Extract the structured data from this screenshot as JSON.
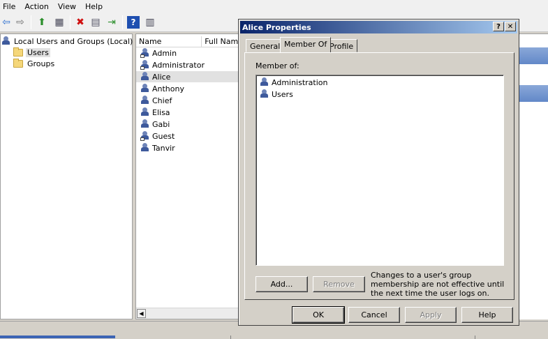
{
  "menu": [
    "File",
    "Action",
    "View",
    "Help"
  ],
  "toolbar": {
    "icons": [
      "back-arrow-icon",
      "forward-arrow-icon",
      "up-folder-icon",
      "show-hide-tree-icon",
      "delete-icon",
      "properties-icon",
      "export-list-icon",
      "help-icon",
      "show-hide-action-pane-icon"
    ],
    "glyphs": {
      "back": "⇦",
      "forward": "⇨",
      "up": "⬆",
      "tree": "▦",
      "delete": "✖",
      "props": "▤",
      "export": "⇥",
      "help": "?",
      "pane": "▥"
    },
    "colors": {
      "back": "#2e6fd0",
      "forward": "#707070",
      "delete": "#d01010",
      "help": "#1e4fb0"
    }
  },
  "tree": {
    "root": "Local Users and Groups (Local)",
    "children": [
      "Users",
      "Groups"
    ],
    "selected": "Users"
  },
  "list": {
    "columns": [
      "Name",
      "Full Nam"
    ],
    "users": [
      "Admin",
      "Administrator",
      "Alice",
      "Anthony",
      "Chief",
      "Elisa",
      "Gabi",
      "Guest",
      "Tanvir"
    ],
    "selected": "Alice"
  },
  "dialog": {
    "title": "Alice Properties",
    "help_btn": "?",
    "close_btn": "✕",
    "tabs": [
      "General",
      "Member Of",
      "Profile"
    ],
    "active_tab": "Member Of",
    "member_of_label": "Member of:",
    "groups": [
      "Administration",
      "Users"
    ],
    "add_button": "Add...",
    "remove_button": "Remove",
    "note": "Changes to a user's group membership are not effective until the next time the user logs on.",
    "buttons": {
      "ok": "OK",
      "cancel": "Cancel",
      "apply": "Apply",
      "help": "Help"
    }
  }
}
